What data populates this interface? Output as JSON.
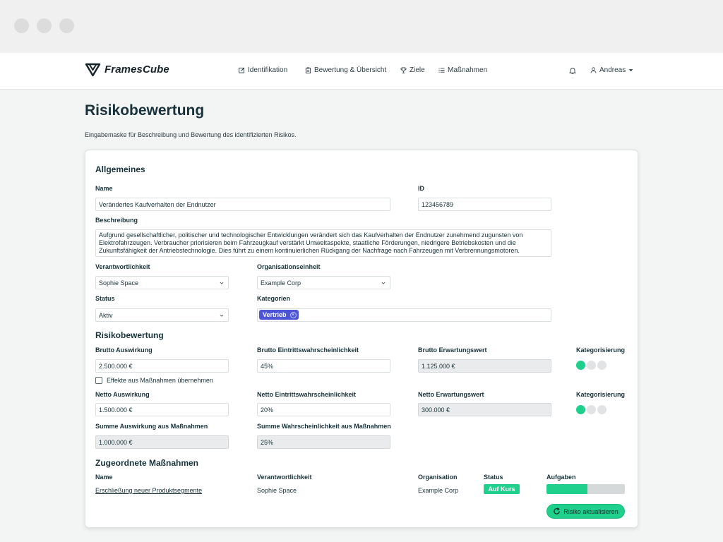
{
  "app": {
    "name": "FramesCube",
    "logo_icon": "framescube-logo-icon"
  },
  "nav": {
    "items": [
      {
        "label": "Identifikation",
        "icon": "edit-icon"
      },
      {
        "label": "Bewertung & Übersicht",
        "icon": "clipboard-icon"
      },
      {
        "label": "Ziele",
        "icon": "trophy-icon"
      },
      {
        "label": "Maßnahmen",
        "icon": "list-icon"
      }
    ],
    "bell_icon": "bell-icon",
    "user": {
      "name": "Andreas",
      "icon": "user-icon"
    }
  },
  "page": {
    "title": "Risikobewertung",
    "subtitle": "Eingabemaske für Beschreibung und Bewertung des identifizierten Risikos."
  },
  "allgemeines": {
    "heading": "Allgemeines",
    "name_label": "Name",
    "name_value": "Verändertes Kaufverhalten der Endnutzer",
    "id_label": "ID",
    "id_value": "123456789",
    "beschreibung_label": "Beschreibung",
    "beschreibung_lines": [
      "Aufgrund gesellschaftlicher, politischer und technologischer Entwicklungen verändert sich das Kaufverhalten der Endnutzer zunehmend zugunsten von",
      "Elektrofahrzeugen. Verbraucher priorisieren beim Fahrzeugkauf verstärkt Umweltaspekte, staatliche Förderungen, niedrigere Betriebskosten und die",
      "Zukunftsfähigkeit der Antriebstechnologie. Dies führt zu einem kontinuierlichen Rückgang der Nachfrage nach Fahrzeugen mit Verbrennungsmotoren."
    ],
    "verantwortlichkeit_label": "Verantwortlichkeit",
    "verantwortlichkeit_value": "Sophie Space",
    "organisationseinheit_label": "Organisationseinheit",
    "organisationseinheit_value": "Example Corp",
    "status_label": "Status",
    "status_value": "Aktiv",
    "kategorien_label": "Kategorien",
    "kategorie_chip": "Vertrieb"
  },
  "risikobewertung": {
    "heading": "Risikobewertung",
    "brutto_auswirkung_label": "Brutto Auswirkung",
    "brutto_auswirkung_value": "2.500.000 €",
    "brutto_ew_label": "Brutto Eintrittswahrscheinlichkeit",
    "brutto_ew_value": "45%",
    "brutto_erwartungswert_label": "Brutto Erwartungswert",
    "brutto_erwartungswert_value": "1.125.000 €",
    "kategorisierung_label": "Kategorisierung",
    "brutto_kategorisierung_level": 1,
    "effekte_label": "Effekte aus Maßnahmen übernehmen",
    "effekte_checked": false,
    "netto_auswirkung_label": "Netto Auswirkung",
    "netto_auswirkung_value": "1.500.000 €",
    "netto_ew_label": "Netto Eintrittswahrscheinlichkeit",
    "netto_ew_value": "20%",
    "netto_erwartungswert_label": "Netto Erwartungswert",
    "netto_erwartungswert_value": "300.000 €",
    "netto_kategorisierung_level": 1,
    "summe_auswirkung_label": "Summe Auswirkung aus Maßnahmen",
    "summe_auswirkung_value": "1.000.000 €",
    "summe_wahrscheinlichkeit_label": "Summe Wahrscheinlichkeit aus Maßnahmen",
    "summe_wahrscheinlichkeit_value": "25%"
  },
  "massnahmen": {
    "heading": "Zugeordnete Maßnahmen",
    "columns": {
      "name": "Name",
      "verantwortlichkeit": "Verantwortlichkeit",
      "organisation": "Organisation",
      "status": "Status",
      "aufgaben": "Aufgaben"
    },
    "rows": [
      {
        "name": "Erschließung neuer Produktsegmente",
        "verantwortlichkeit": "Sophie Space",
        "organisation": "Example Corp",
        "status": "Auf Kurs",
        "aufgaben_progress": 0.52
      }
    ],
    "update_button": "Risiko aktualisieren",
    "update_icon": "refresh-icon"
  },
  "colors": {
    "accent": "#1fd08d",
    "chip": "#4d54d8",
    "text": "#17323a"
  }
}
